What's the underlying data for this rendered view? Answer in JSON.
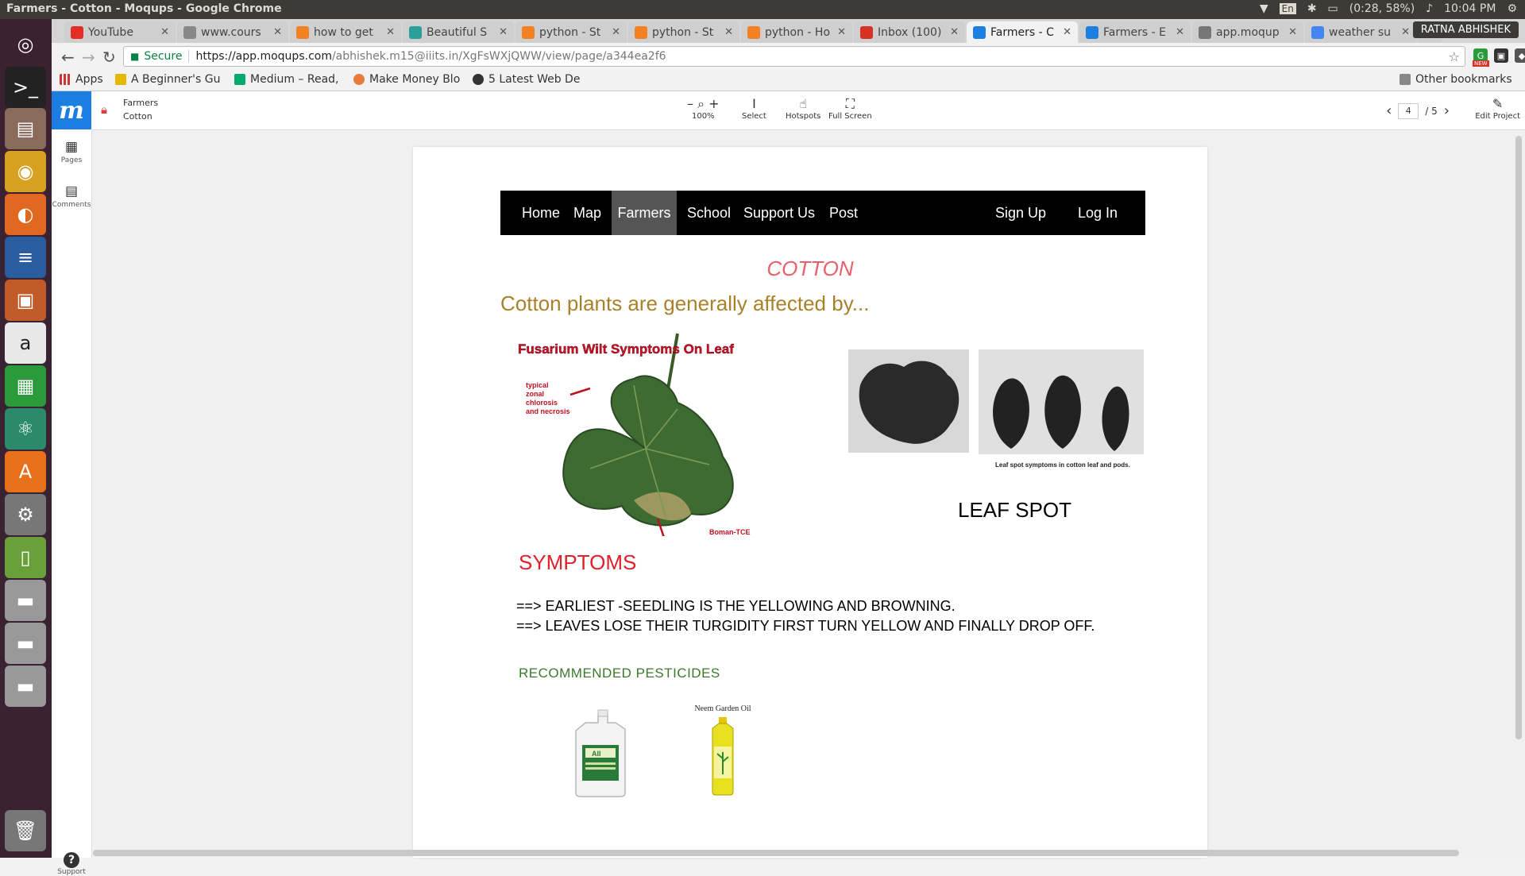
{
  "os": {
    "window_title": "Farmers - Cotton - Moqups - Google Chrome",
    "keyboard": "En",
    "battery": "(0:28, 58%)",
    "time": "10:04 PM"
  },
  "browser": {
    "tabs": [
      {
        "label": "YouTube",
        "favicon": "youtube-icon",
        "color": "#e52d27"
      },
      {
        "label": "www.cours",
        "favicon": "link-icon",
        "color": "#888888"
      },
      {
        "label": "how to get",
        "favicon": "stackoverflow-icon",
        "color": "#f48024"
      },
      {
        "label": "Beautiful S",
        "favicon": "c-icon",
        "color": "#2aa198"
      },
      {
        "label": "python - St",
        "favicon": "stackoverflow-icon",
        "color": "#f48024"
      },
      {
        "label": "python - St",
        "favicon": "stackoverflow-icon",
        "color": "#f48024"
      },
      {
        "label": "python - Ho",
        "favicon": "stackoverflow-icon",
        "color": "#f48024"
      },
      {
        "label": "Inbox (100)",
        "favicon": "gmail-icon",
        "color": "#d93025"
      },
      {
        "label": "Farmers - C",
        "favicon": "moqups-icon",
        "color": "#1a7fe0",
        "active": true
      },
      {
        "label": "Farmers - E",
        "favicon": "moqups-icon",
        "color": "#1a7fe0"
      },
      {
        "label": "app.moqup",
        "favicon": "moqups-m-icon",
        "color": "#777777"
      },
      {
        "label": "weather su",
        "favicon": "google-icon",
        "color": "#4285f4"
      }
    ],
    "user": "RATNA ABHISHEK",
    "url_secure": "Secure",
    "url_host": "https://app.moqups.com",
    "url_path": "/abhishek.m15@iiits.in/XgFsWXjQWW/view/page/a344ea2f6",
    "extension_badge": "NEW",
    "bookmarks": [
      {
        "label": "Apps",
        "icon": "apps-grid-icon"
      },
      {
        "label": "A Beginner's Gu",
        "icon": "bookmark-k-icon"
      },
      {
        "label": "Medium – Read,",
        "icon": "medium-icon"
      },
      {
        "label": "Make Money Blo",
        "icon": "bookmark-icon"
      },
      {
        "label": "5 Latest Web De",
        "icon": "bookmark-rs-icon"
      }
    ],
    "other_bookmarks": "Other bookmarks"
  },
  "moqups": {
    "breadcrumb_project": "Farmers",
    "breadcrumb_page": "Cotton",
    "toolbar": {
      "zoom": "100%",
      "select": "Select",
      "hotspots": "Hotspots",
      "fullscreen": "Full Screen",
      "edit": "Edit Project"
    },
    "page_current": "4",
    "page_total": "/ 5",
    "rail": {
      "pages": "Pages",
      "comments": "Comments",
      "support": "Support"
    }
  },
  "site": {
    "nav": {
      "home": "Home",
      "map": "Map",
      "farmers": "Farmers",
      "school": "School",
      "support_us": "Support Us",
      "post": "Post",
      "sign_up": "Sign Up",
      "log_in": "Log In"
    },
    "title": "COTTON",
    "intro": "Cotton plants are generally affected by...",
    "fusarium_image_title": "Fusarium Wilt Symptoms On Leaf",
    "fusarium_image_note": [
      "typical",
      "zonal",
      "chlorosis",
      "and necrosis"
    ],
    "fusarium_image_credit": "Boman-TCE",
    "leafspot_caption": "Leaf spot symptoms in cotton leaf and pods.",
    "leafspot_title": "LEAF SPOT",
    "symptoms_title": "SYMPTOMS",
    "symptoms": [
      "==> EARLIEST -SEEDLING IS THE YELLOWING AND BROWNING.",
      "==> LEAVES LOSE THEIR TURGIDITY FIRST TURN YELLOW AND FINALLY DROP OFF."
    ],
    "pesticides_title": "RECOMMENDED  PESTICIDES",
    "product_jug_label": "All",
    "product_neem_label": "Neem Garden Oil"
  }
}
